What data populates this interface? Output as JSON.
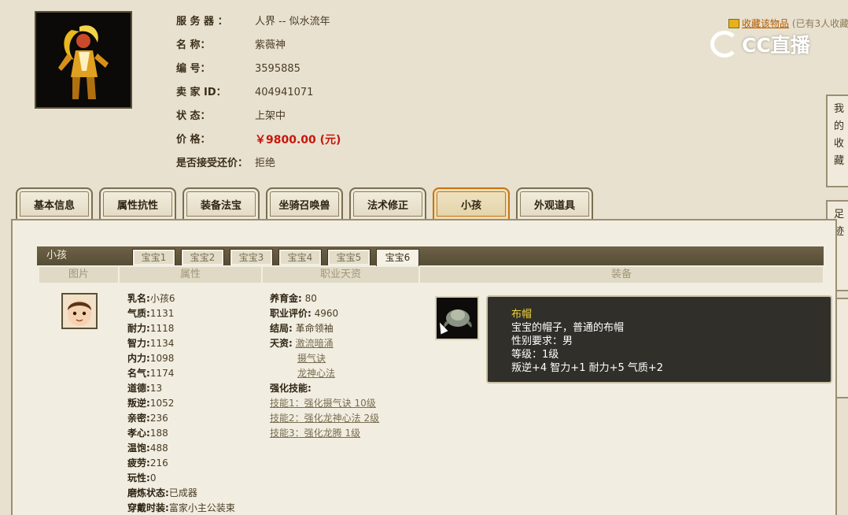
{
  "header": {
    "server_label": "服 务 器 ：",
    "server_value": "人界 -- 似水流年",
    "name_label": "名        称：",
    "name_value": "紫薇神",
    "id_label": "编        号：",
    "id_value": "3595885",
    "seller_label": "卖  家     ID：",
    "seller_value": "404941071",
    "status_label": "状        态：",
    "status_value": "上架中",
    "price_label": "价        格：",
    "price_value": "￥9800.00 (元)",
    "bargain_label": "是否接受还价：",
    "bargain_value": "拒绝"
  },
  "favorite": {
    "link_text": "收藏该物品",
    "count_text": "(已有3人收藏"
  },
  "watermark": {
    "text": "CC直播"
  },
  "side_panels": {
    "panel1_text": "我的收藏",
    "panel2_text": "足迹"
  },
  "tabs": [
    {
      "label": "基本信息"
    },
    {
      "label": "属性抗性"
    },
    {
      "label": "装备法宝"
    },
    {
      "label": "坐骑召唤兽"
    },
    {
      "label": "法术修正"
    },
    {
      "label": "小孩"
    },
    {
      "label": "外观道具"
    }
  ],
  "kid_section": {
    "title": "小孩",
    "subtabs": [
      "宝宝1",
      "宝宝2",
      "宝宝3",
      "宝宝4",
      "宝宝5",
      "宝宝6"
    ],
    "columns": [
      "图片",
      "属性",
      "职业天资",
      "装备"
    ]
  },
  "attrs": [
    {
      "k": "乳名:",
      "v": "小孩6"
    },
    {
      "k": "气质:",
      "v": "1131"
    },
    {
      "k": "耐力:",
      "v": "1118"
    },
    {
      "k": "智力:",
      "v": "1134"
    },
    {
      "k": "内力:",
      "v": "1098"
    },
    {
      "k": "名气:",
      "v": "1174"
    },
    {
      "k": "道德:",
      "v": "13"
    },
    {
      "k": "叛逆:",
      "v": "1052"
    },
    {
      "k": "亲密:",
      "v": "236"
    },
    {
      "k": "孝心:",
      "v": "188"
    },
    {
      "k": "温饱:",
      "v": "488"
    },
    {
      "k": "疲劳:",
      "v": "216"
    },
    {
      "k": "玩性:",
      "v": "0"
    },
    {
      "k": "磨炼状态:",
      "v": "已成器"
    },
    {
      "k": "穿戴时装:",
      "v": "富家小主公装束"
    }
  ],
  "job": {
    "fund_label": "养育金:",
    "fund_value": "80",
    "rating_label": "职业评价:",
    "rating_value": "4960",
    "ending_label": "结局:",
    "ending_value": "革命领袖",
    "talent_label": "天资:",
    "talents": [
      "激流暗涌",
      "摄气诀",
      "龙神心法"
    ],
    "skills_label": "强化技能:",
    "skills": [
      "技能1：强化摄气诀 10级",
      "技能2：强化龙神心法 2级",
      "技能3：强化龙腾 1级"
    ]
  },
  "tooltip": {
    "name": "布帽",
    "desc": "宝宝的帽子，普通的布帽",
    "gender": "性别要求：男",
    "level": "等级：1级",
    "stats": "叛逆+4 智力+1 耐力+5 气质+2"
  }
}
